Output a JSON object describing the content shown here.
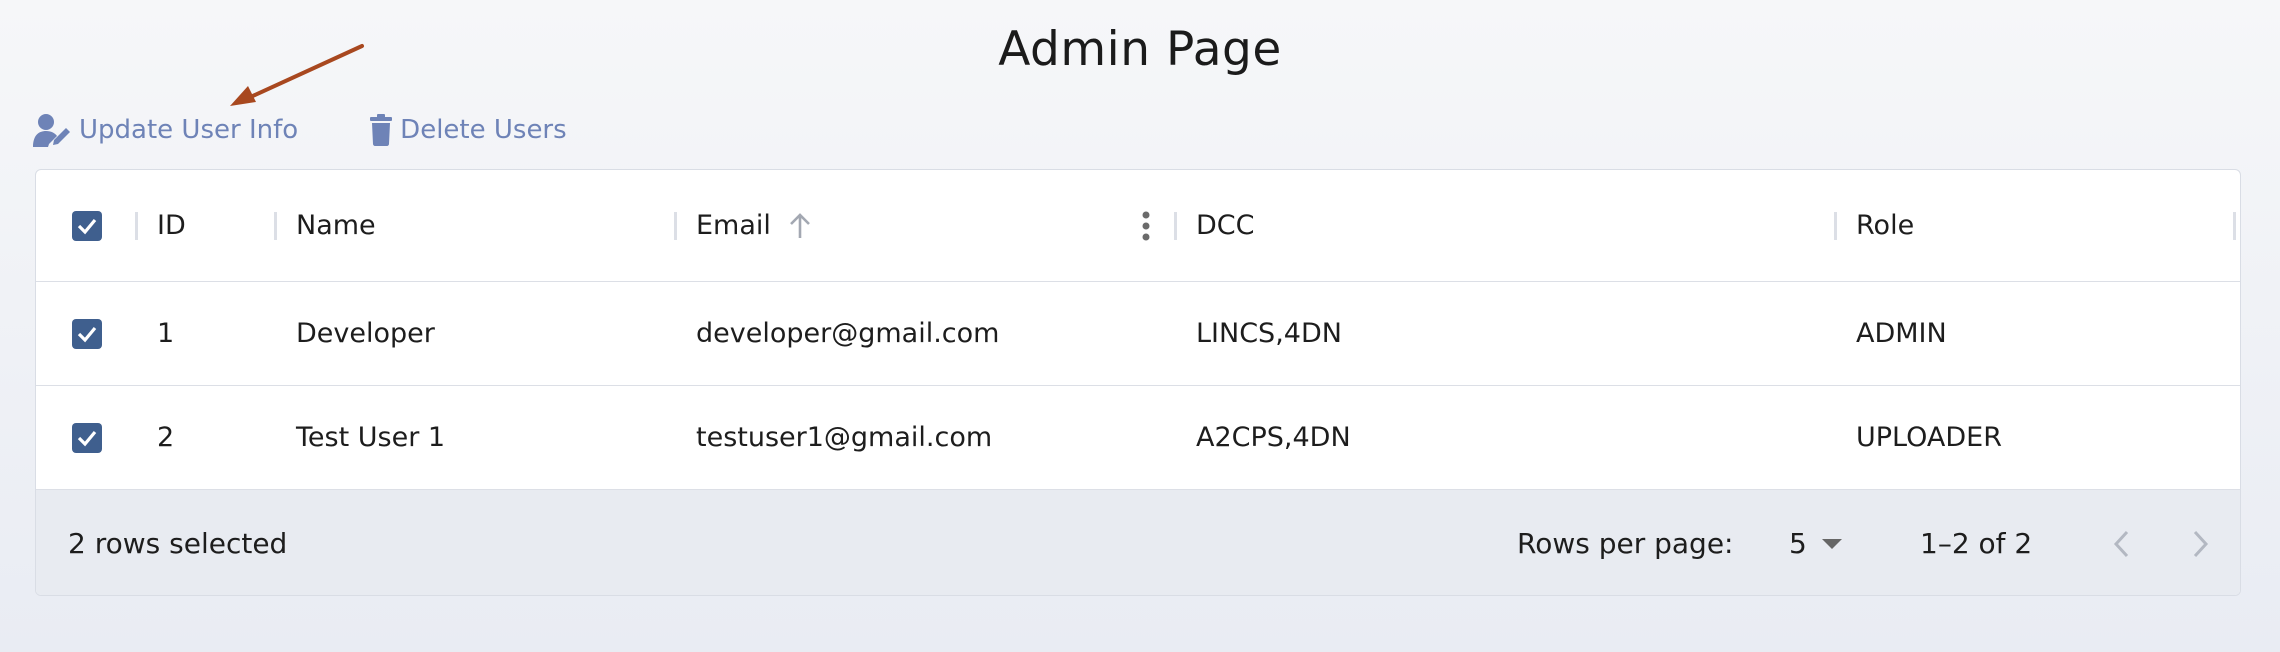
{
  "page": {
    "title": "Admin Page"
  },
  "toolbar": {
    "update_label": "Update User Info",
    "delete_label": "Delete Users"
  },
  "table": {
    "columns": [
      "ID",
      "Name",
      "Email",
      "DCC",
      "Role"
    ],
    "sort": {
      "column": "Email",
      "direction": "ascending"
    },
    "rows": [
      {
        "id": "1",
        "name": "Developer",
        "email": "developer@gmail.com",
        "dcc": "LINCS,4DN",
        "role": "ADMIN",
        "selected": true
      },
      {
        "id": "2",
        "name": "Test User 1",
        "email": "testuser1@gmail.com",
        "dcc": "A2CPS,4DN",
        "role": "UPLOADER",
        "selected": true
      }
    ]
  },
  "footer": {
    "selected_text": "2 rows selected",
    "rows_per_page_label": "Rows per page:",
    "rows_per_page_value": "5",
    "range_text": "1–2 of 2"
  },
  "colors": {
    "accent": "#3f5f8e",
    "toolbar_text": "#6e83b7",
    "annotation_arrow": "#a8481f"
  },
  "icons": {
    "update": "person-edit-icon",
    "delete": "trash-icon",
    "sort": "arrow-up-icon",
    "column_menu": "vertical-dots-icon",
    "dropdown": "caret-down-icon",
    "prev": "chevron-left-icon",
    "next": "chevron-right-icon"
  }
}
